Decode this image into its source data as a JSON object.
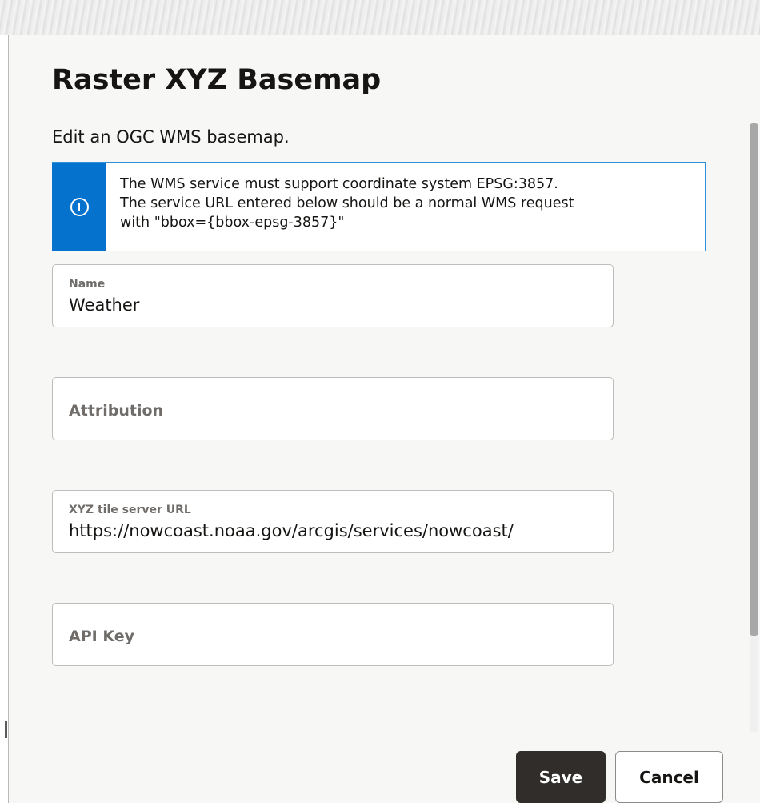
{
  "dialog": {
    "title": "Raster XYZ Basemap",
    "subtitle": "Edit an OGC WMS basemap."
  },
  "info_banner": {
    "icon": "info-icon",
    "lines": [
      "The WMS service must support coordinate system EPSG:3857.",
      "The service URL entered below should be a normal WMS request",
      "with \"bbox={bbox-epsg-3857}\""
    ]
  },
  "fields": {
    "name": {
      "label": "Name",
      "value": "Weather"
    },
    "attribution": {
      "label": "Attribution",
      "value": ""
    },
    "tile_url": {
      "label": "XYZ tile server URL",
      "value": "https://nowcoast.noaa.gov/arcgis/services/nowcoast/"
    },
    "api_key": {
      "label": "API Key",
      "value": ""
    }
  },
  "buttons": {
    "save": "Save",
    "cancel": "Cancel"
  },
  "colors": {
    "info_accent": "#0572ce",
    "primary_button": "#312d2a"
  }
}
